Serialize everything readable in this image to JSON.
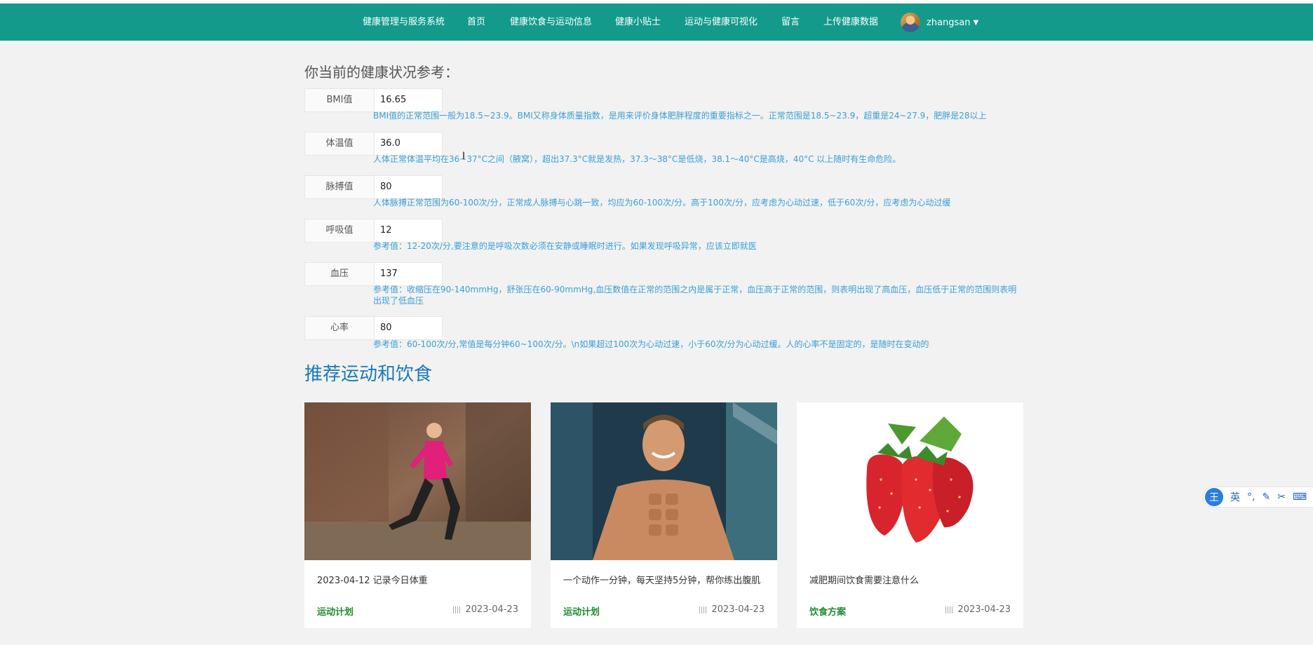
{
  "navbar": {
    "items": [
      "健康管理与服务系统",
      "首页",
      "健康饮食与运动信息",
      "健康小贴士",
      "运动与健康可视化",
      "留言",
      "上传健康数据"
    ],
    "username": "zhangsan"
  },
  "health": {
    "title": "你当前的健康状况参考：",
    "metrics": [
      {
        "label": "BMI值",
        "value": "16.65",
        "note": "BMI值的正常范围一般为18.5~23.9。BMI又称身体质量指数，是用来评价身体肥胖程度的重要指标之一。正常范围是18.5~23.9，超重是24~27.9，肥胖是28以上"
      },
      {
        "label": "体温值",
        "value": "36.0",
        "note": "人体正常体温平均在36~37°C之间（腋窝），超出37.3°C就是发热，37.3～38°C是低烧，38.1～40°C是高烧，40°C 以上随时有生命危险。"
      },
      {
        "label": "脉搏值",
        "value": "80",
        "note": "人体脉搏正常范围为60-100次/分，正常成人脉搏与心跳一致，均应为60-100次/分。高于100次/分，应考虑为心动过速，低于60次/分，应考虑为心动过缓"
      },
      {
        "label": "呼吸值",
        "value": "12",
        "note": "参考值：12-20次/分,要注意的是呼吸次数必须在安静或睡眠时进行。如果发现呼吸异常，应该立即就医"
      },
      {
        "label": "血压",
        "value": "137",
        "note": "参考值：收缩压在90-140mmHg，舒张压在60-90mmHg,血压数值在正常的范围之内是属于正常，血压高于正常的范围，则表明出现了高血压，血压低于正常的范围则表明出现了低血压"
      },
      {
        "label": "心率",
        "value": "80",
        "note": "参考值：60-100次/分,常值是每分钟60~100次/分。\\n如果超过100次为心动过速，小于60次/分为心动过缓。人的心率不是固定的，是随时在变动的"
      }
    ]
  },
  "recommend": {
    "title": "推荐运动和饮食",
    "cards": [
      {
        "title": "2023-04-12 记录今日体重",
        "category": "运动计划",
        "date": "2023-04-23"
      },
      {
        "title": "一个动作一分钟，每天坚持5分钟，帮你练出腹肌",
        "category": "运动计划",
        "date": "2023-04-23"
      },
      {
        "title": "减肥期间饮食需要注意什么",
        "category": "饮食方案",
        "date": "2023-04-23"
      }
    ]
  },
  "ime": {
    "logo": "王",
    "mode": "英"
  }
}
